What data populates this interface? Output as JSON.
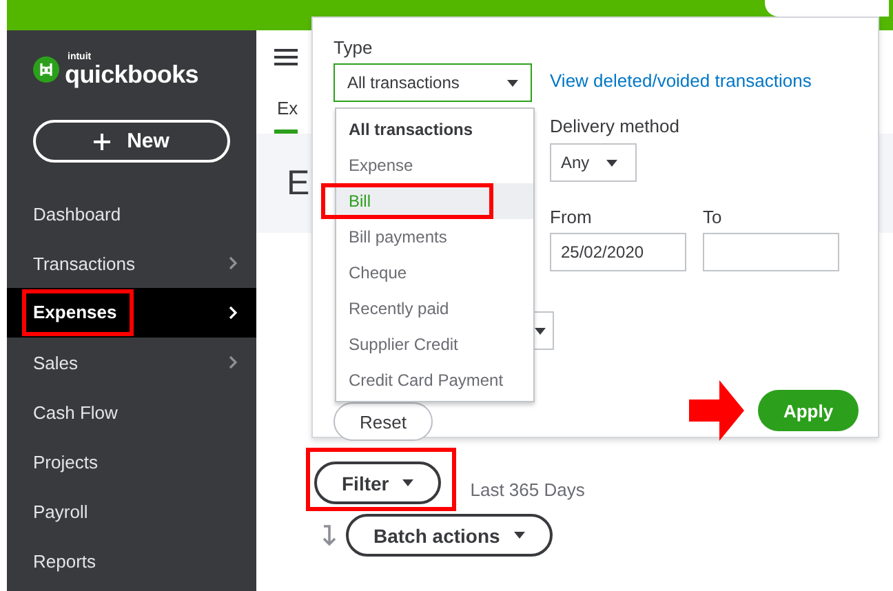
{
  "logo": {
    "brand": "intuit",
    "name": "quickbooks"
  },
  "new_button": {
    "label": "New"
  },
  "sidebar": {
    "items": [
      {
        "label": "Dashboard",
        "selected": false,
        "has_chevron": false,
        "highlighted": false
      },
      {
        "label": "Transactions",
        "selected": false,
        "has_chevron": true,
        "highlighted": false
      },
      {
        "label": "Expenses",
        "selected": true,
        "has_chevron": true,
        "highlighted": true
      },
      {
        "label": "Sales",
        "selected": false,
        "has_chevron": true,
        "highlighted": false
      },
      {
        "label": "Cash Flow",
        "selected": false,
        "has_chevron": false,
        "highlighted": false
      },
      {
        "label": "Projects",
        "selected": false,
        "has_chevron": false,
        "highlighted": false
      },
      {
        "label": "Payroll",
        "selected": false,
        "has_chevron": false,
        "highlighted": false
      },
      {
        "label": "Reports",
        "selected": false,
        "has_chevron": false,
        "highlighted": false
      }
    ]
  },
  "tabs": [
    {
      "label": "Ex",
      "selected": true
    }
  ],
  "page_title": "E",
  "filter_panel": {
    "type_label": "Type",
    "type_value": "All transactions",
    "link": "View deleted/voided transactions",
    "type_options": [
      {
        "label": "All transactions",
        "selected": false,
        "highlighted": false
      },
      {
        "label": "Expense",
        "selected": false,
        "highlighted": false
      },
      {
        "label": "Bill",
        "selected": true,
        "highlighted": true
      },
      {
        "label": "Bill payments",
        "selected": false,
        "highlighted": false
      },
      {
        "label": "Cheque",
        "selected": false,
        "highlighted": false
      },
      {
        "label": "Recently paid",
        "selected": false,
        "highlighted": false
      },
      {
        "label": "Supplier Credit",
        "selected": false,
        "highlighted": false
      },
      {
        "label": "Credit Card Payment",
        "selected": false,
        "highlighted": false
      }
    ],
    "delivery_label": "Delivery method",
    "delivery_value": "Any",
    "from_label": "From",
    "from_value": "25/02/2020",
    "to_label": "To",
    "reset_button": "Reset",
    "apply_button": {
      "label": "Apply",
      "pointed_at": true
    }
  },
  "filter_button": {
    "label": "Filter",
    "highlighted": true
  },
  "date_range": "Last 365 Days",
  "batch_button": "Batch actions"
}
